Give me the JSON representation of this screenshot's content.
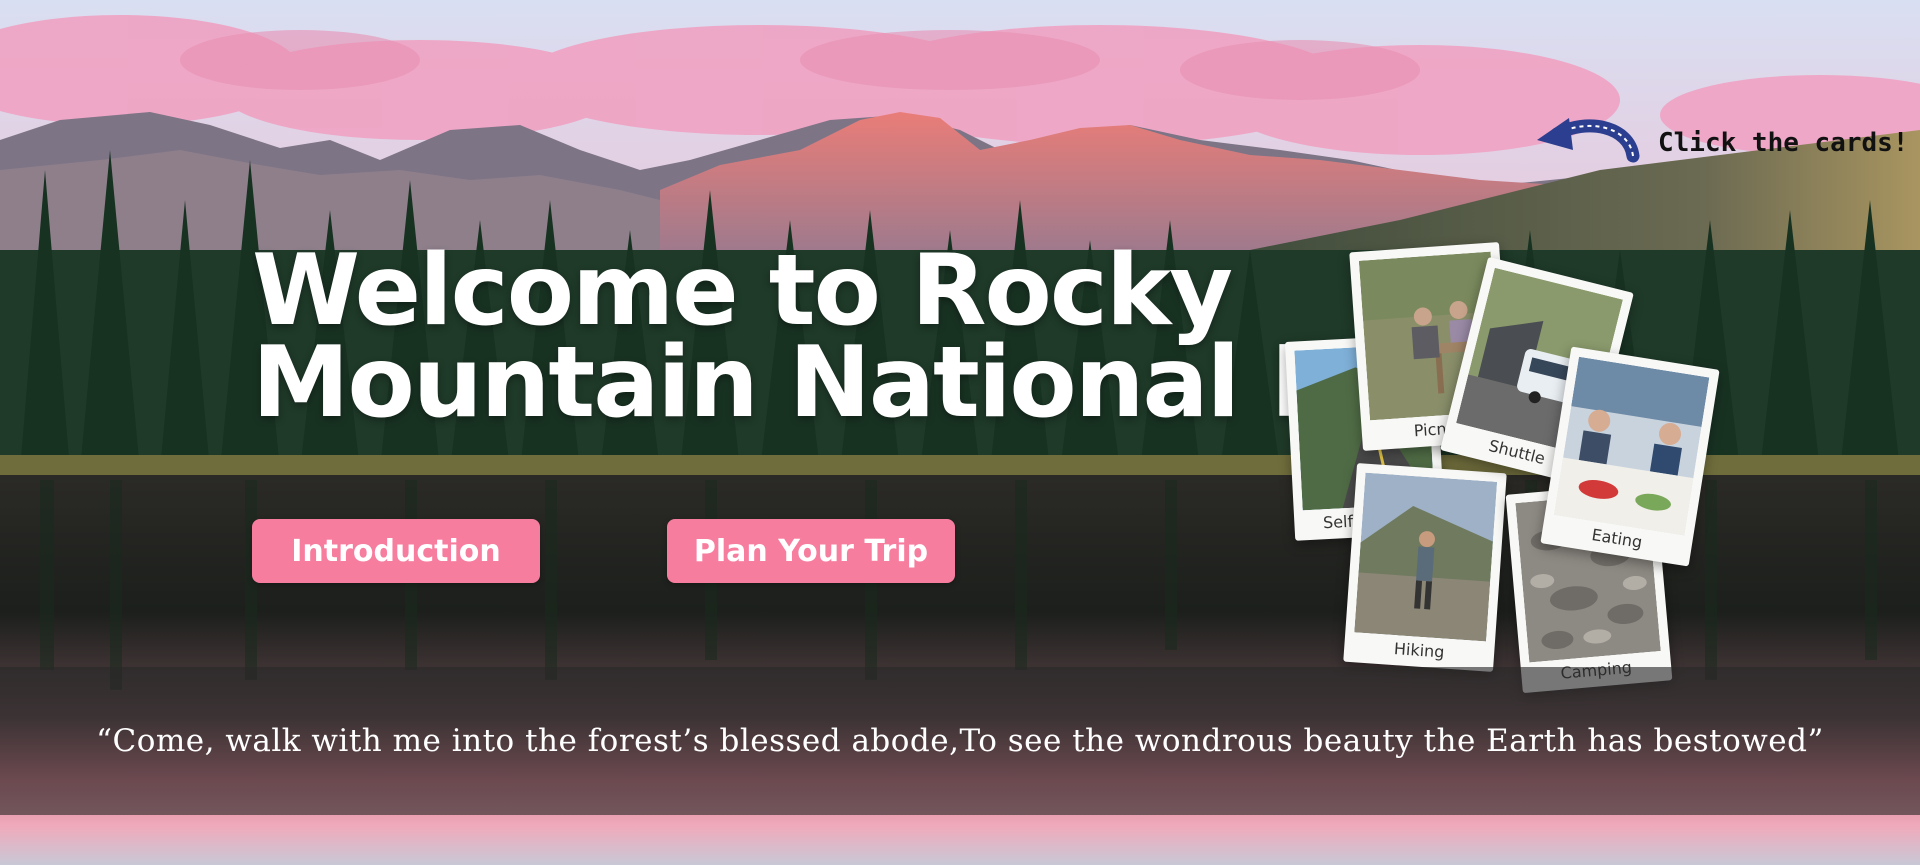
{
  "hero": {
    "title_line1": "Welcome to Rocky",
    "title_line2": "Mountain National Park"
  },
  "buttons": {
    "introduction": "Introduction",
    "plan_trip": "Plan Your Trip"
  },
  "hint": {
    "text": "Click the cards!",
    "icon": "curved-arrow-icon"
  },
  "cards": [
    {
      "label": "Self Driving"
    },
    {
      "label": "Hiking"
    },
    {
      "label": "Picnic"
    },
    {
      "label": "Camping"
    },
    {
      "label": "Shuttle"
    },
    {
      "label": "Eating"
    }
  ],
  "quote": {
    "text": "“Come, walk with me into the forest’s blessed abode,To see the wondrous beauty the Earth has bestowed”"
  },
  "colors": {
    "button": "#f77d9f",
    "hint_arrow": "#2c3e8f",
    "sky_pink": "#f2a3c0",
    "peak_glow": "#e8796f"
  }
}
